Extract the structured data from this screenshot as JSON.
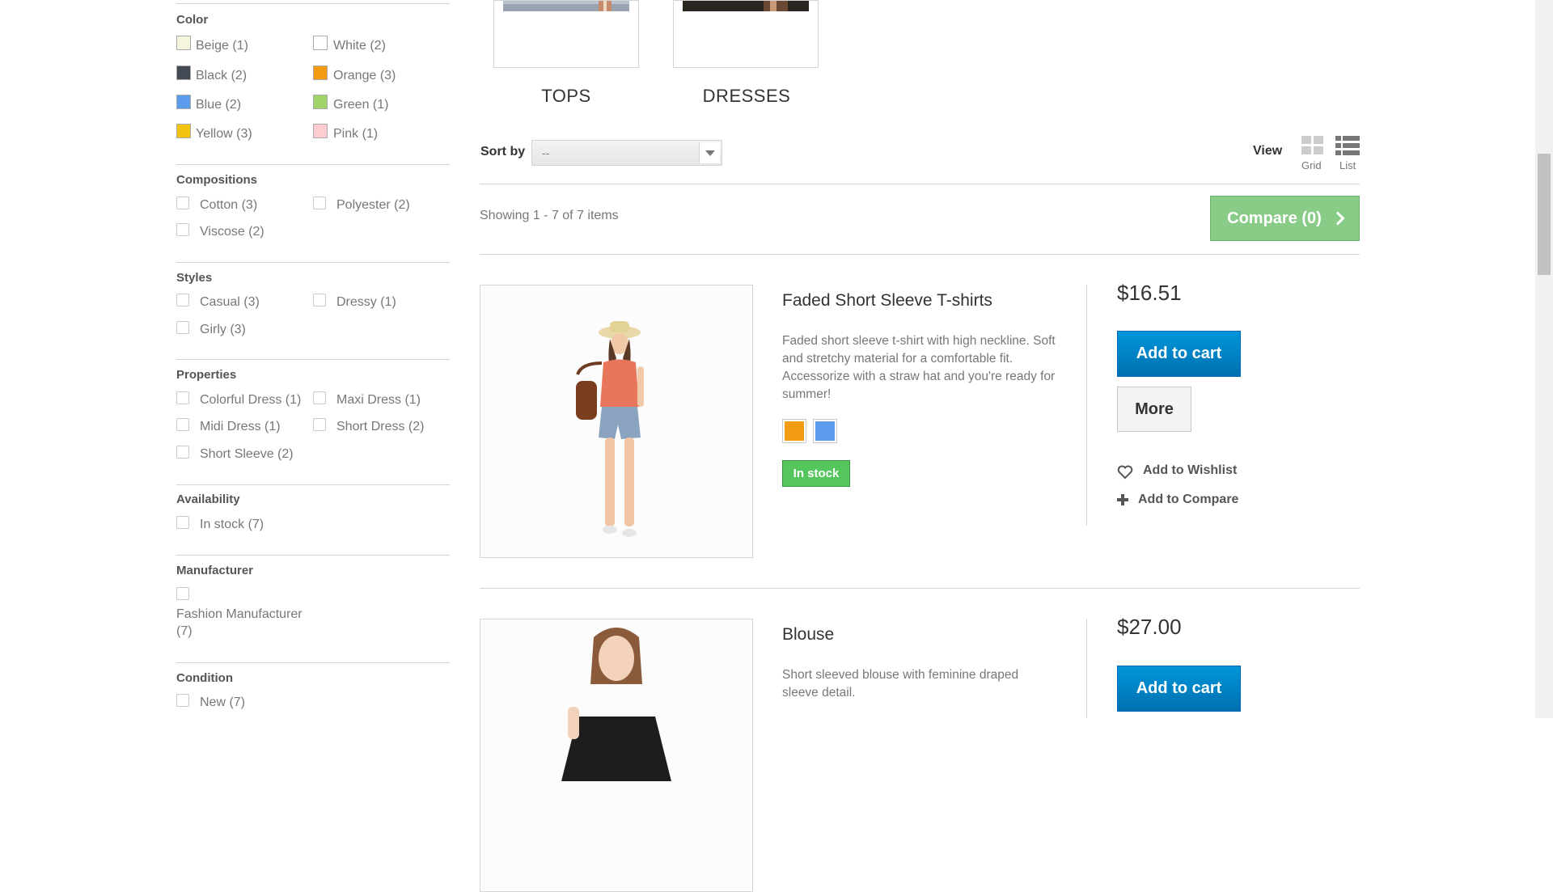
{
  "filters": {
    "color": {
      "title": "Color",
      "items": [
        {
          "label": "Beige (1)",
          "color": "#f5f5dc"
        },
        {
          "label": "White (2)",
          "color": "#ffffff"
        },
        {
          "label": "Black (2)",
          "color": "#434a54"
        },
        {
          "label": "Orange (3)",
          "color": "#f39c11"
        },
        {
          "label": "Blue (2)",
          "color": "#5d9cec"
        },
        {
          "label": "Green (1)",
          "color": "#a0d468"
        },
        {
          "label": "Yellow (3)",
          "color": "#f1c40f"
        },
        {
          "label": "Pink (1)",
          "color": "#fcccd1"
        }
      ]
    },
    "compositions": {
      "title": "Compositions",
      "items": [
        "Cotton (3)",
        "Polyester (2)",
        "Viscose (2)"
      ]
    },
    "styles": {
      "title": "Styles",
      "items": [
        "Casual (3)",
        "Dressy (1)",
        "Girly (3)"
      ]
    },
    "properties": {
      "title": "Properties",
      "items": [
        "Colorful Dress (1)",
        "Maxi Dress (1)",
        "Midi Dress (1)",
        "Short Dress (2)",
        "Short Sleeve (2)"
      ]
    },
    "availability": {
      "title": "Availability",
      "items": [
        "In stock (7)"
      ]
    },
    "manufacturer": {
      "title": "Manufacturer",
      "items": [
        "Fashion Manufacturer",
        "(7)"
      ]
    },
    "condition": {
      "title": "Condition",
      "items": [
        "New (7)"
      ]
    }
  },
  "categories": [
    {
      "name": "TOPS"
    },
    {
      "name": "DRESSES"
    }
  ],
  "toolbar": {
    "sort_label": "Sort by",
    "sort_value": "--",
    "view_label": "View",
    "grid_label": "Grid",
    "list_label": "List"
  },
  "listing": {
    "showing": "Showing 1 - 7 of 7 items",
    "compare_label": "Compare (0)"
  },
  "products": [
    {
      "name": "Faded Short Sleeve T-shirts",
      "description": "Faded short sleeve t-shirt with high neckline. Soft and stretchy material for a comfortable fit. Accessorize with a straw hat and you're ready for summer!",
      "price": "$16.51",
      "add_to_cart": "Add to cart",
      "more": "More",
      "colors": [
        "#f39c11",
        "#5d9cec"
      ],
      "stock": "In stock",
      "wishlist": "Add to Wishlist",
      "compare": "Add to Compare"
    },
    {
      "name": "Blouse",
      "description": "Short sleeved blouse with feminine draped sleeve detail.",
      "price": "$27.00",
      "add_to_cart": "Add to cart"
    }
  ]
}
